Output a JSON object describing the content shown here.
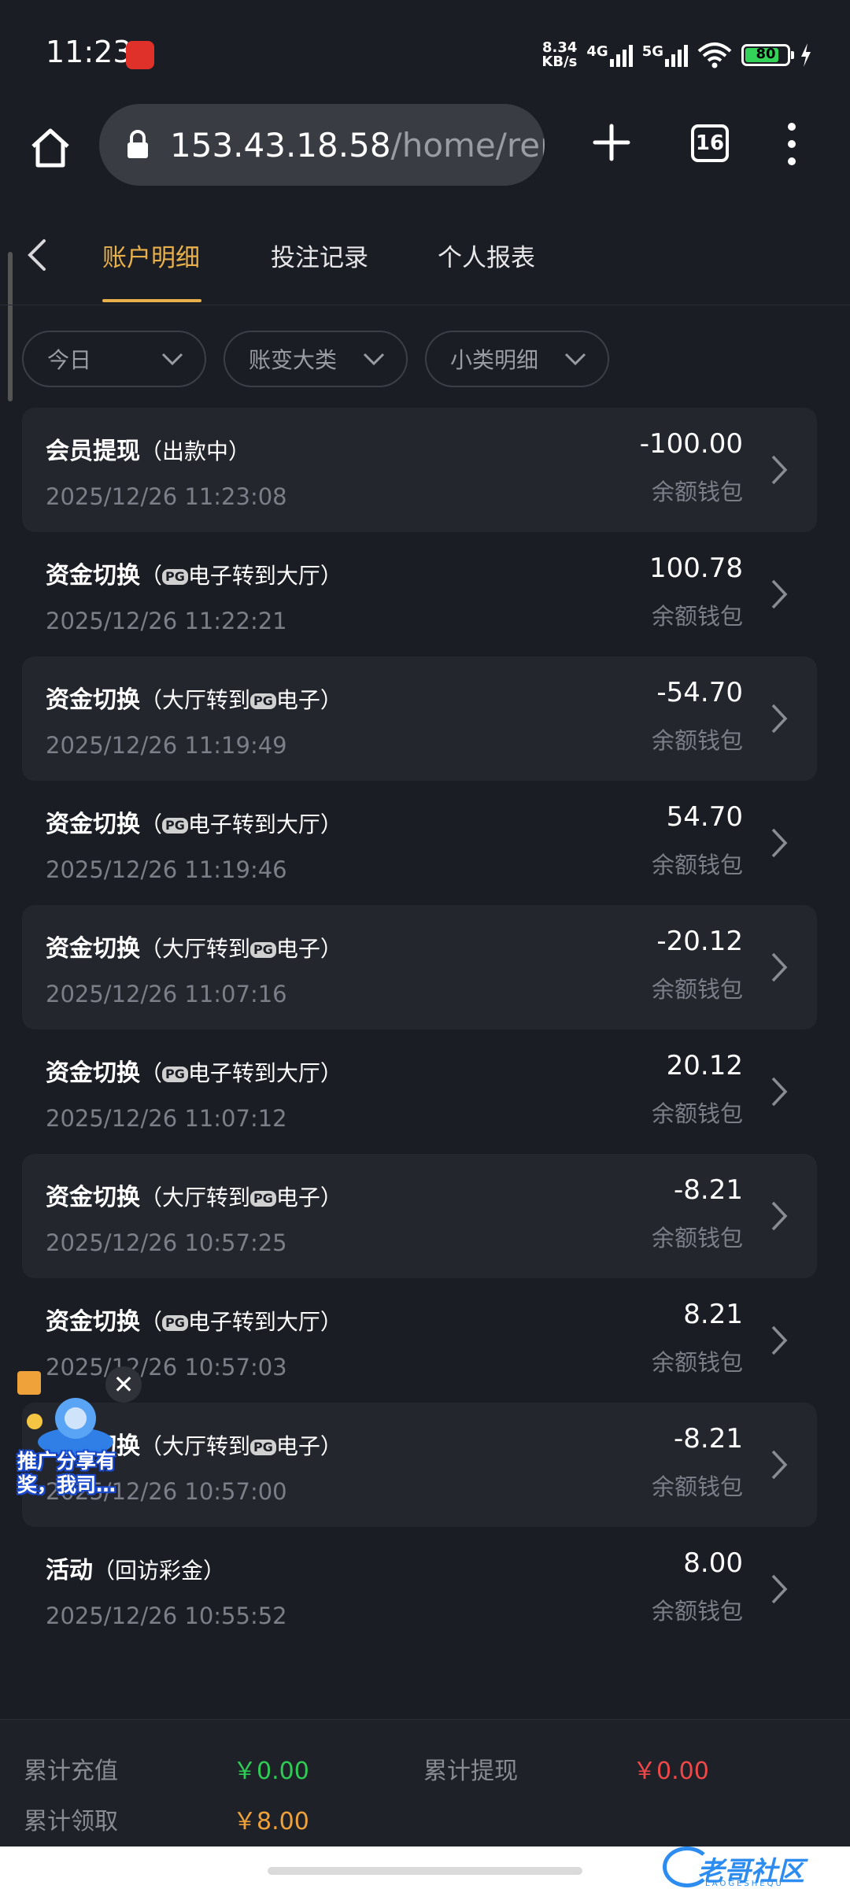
{
  "status": {
    "time": "11:23",
    "net_speed_value": "8.34",
    "net_speed_unit": "KB/s",
    "net1": "4G",
    "net2": "5G",
    "battery": "80"
  },
  "browser": {
    "url_main": "153.43.18.58",
    "url_path": "/home/repo",
    "tab_count": "16"
  },
  "tabs": [
    {
      "label": "账户明细",
      "active": true
    },
    {
      "label": "投注记录",
      "active": false
    },
    {
      "label": "个人报表",
      "active": false
    }
  ],
  "filters": [
    {
      "label": "今日"
    },
    {
      "label": "账变大类"
    },
    {
      "label": "小类明细"
    }
  ],
  "pg_logo": "PG",
  "rows": [
    {
      "title": "会员提现",
      "sub_prefix": "（出款中）",
      "sub_suffix": "",
      "pg": false,
      "time": "2025/12/26 11:23:08",
      "amount": "-100.00",
      "wallet": "余额钱包"
    },
    {
      "title": "资金切换",
      "sub_prefix": "（",
      "sub_suffix": "电子转到大厅）",
      "pg": true,
      "time": "2025/12/26 11:22:21",
      "amount": "100.78",
      "wallet": "余额钱包"
    },
    {
      "title": "资金切换",
      "sub_prefix": "（大厅转到",
      "sub_suffix": "电子）",
      "pg": true,
      "time": "2025/12/26 11:19:49",
      "amount": "-54.70",
      "wallet": "余额钱包"
    },
    {
      "title": "资金切换",
      "sub_prefix": "（",
      "sub_suffix": "电子转到大厅）",
      "pg": true,
      "time": "2025/12/26 11:19:46",
      "amount": "54.70",
      "wallet": "余额钱包"
    },
    {
      "title": "资金切换",
      "sub_prefix": "（大厅转到",
      "sub_suffix": "电子）",
      "pg": true,
      "time": "2025/12/26 11:07:16",
      "amount": "-20.12",
      "wallet": "余额钱包"
    },
    {
      "title": "资金切换",
      "sub_prefix": "（",
      "sub_suffix": "电子转到大厅）",
      "pg": true,
      "time": "2025/12/26 11:07:12",
      "amount": "20.12",
      "wallet": "余额钱包"
    },
    {
      "title": "资金切换",
      "sub_prefix": "（大厅转到",
      "sub_suffix": "电子）",
      "pg": true,
      "time": "2025/12/26 10:57:25",
      "amount": "-8.21",
      "wallet": "余额钱包"
    },
    {
      "title": "资金切换",
      "sub_prefix": "（",
      "sub_suffix": "电子转到大厅）",
      "pg": true,
      "time": "2025/12/26 10:57:03",
      "amount": "8.21",
      "wallet": "余额钱包"
    },
    {
      "title": "资金切换",
      "sub_prefix": "（大厅转到",
      "sub_suffix": "电子）",
      "pg": true,
      "time": "2025/12/26 10:57:00",
      "amount": "-8.21",
      "wallet": "余额钱包"
    },
    {
      "title": "活动",
      "sub_prefix": "（回访彩金）",
      "sub_suffix": "",
      "pg": false,
      "time": "2025/12/26 10:55:52",
      "amount": "8.00",
      "wallet": "余额钱包"
    }
  ],
  "promo": {
    "text": "推广分享有奖，我司…",
    "close": "✕"
  },
  "footer": {
    "recharge_label": "累计充值",
    "recharge_value": "￥0.00",
    "withdraw_label": "累计提现",
    "withdraw_value": "￥0.00",
    "claim_label": "累计领取",
    "claim_value": "￥8.00"
  },
  "watermark": {
    "text": "老哥社区",
    "sub": "LAOGESHEQU"
  },
  "colors": {
    "accent": "#e8b04a",
    "positive": "#2ecc55",
    "negative": "#f04848",
    "claim": "#f0a23a"
  }
}
